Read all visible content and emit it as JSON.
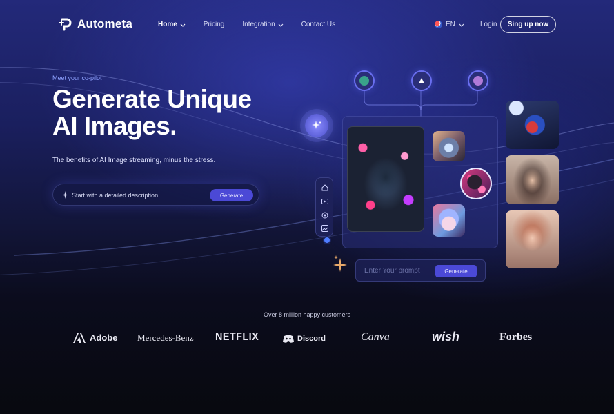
{
  "header": {
    "logo_text": "Autometa",
    "nav": [
      {
        "label": "Home",
        "dropdown": true,
        "active": true
      },
      {
        "label": "Pricing",
        "dropdown": false,
        "active": false
      },
      {
        "label": "Integration",
        "dropdown": true,
        "active": false
      },
      {
        "label": "Contact Us",
        "dropdown": false,
        "active": false
      }
    ],
    "language": "EN",
    "login_label": "Login",
    "signup_label": "Sing up now"
  },
  "hero": {
    "eyebrow": "Meet your co-pilot",
    "headline_line1": "Generate Unique",
    "headline_line2": "AI Images.",
    "subline": "The benefits of AI Image streaming, minus the stress.",
    "search": {
      "placeholder": "Start with a detailed description",
      "button_label": "Generate"
    }
  },
  "generator": {
    "prompt_placeholder": "Enter Your prompt",
    "button_label": "Generate"
  },
  "customers": {
    "caption": "Over 8 million happy customers",
    "brands": [
      "Adobe",
      "Mercedes-Benz",
      "NETFLIX",
      "Discord",
      "Canva",
      "wish",
      "Forbes"
    ]
  },
  "colors": {
    "accent": "#4b49d6",
    "eyebrow": "#8ea1ff",
    "background_top": "#23297a",
    "background_bottom": "#08090f"
  }
}
